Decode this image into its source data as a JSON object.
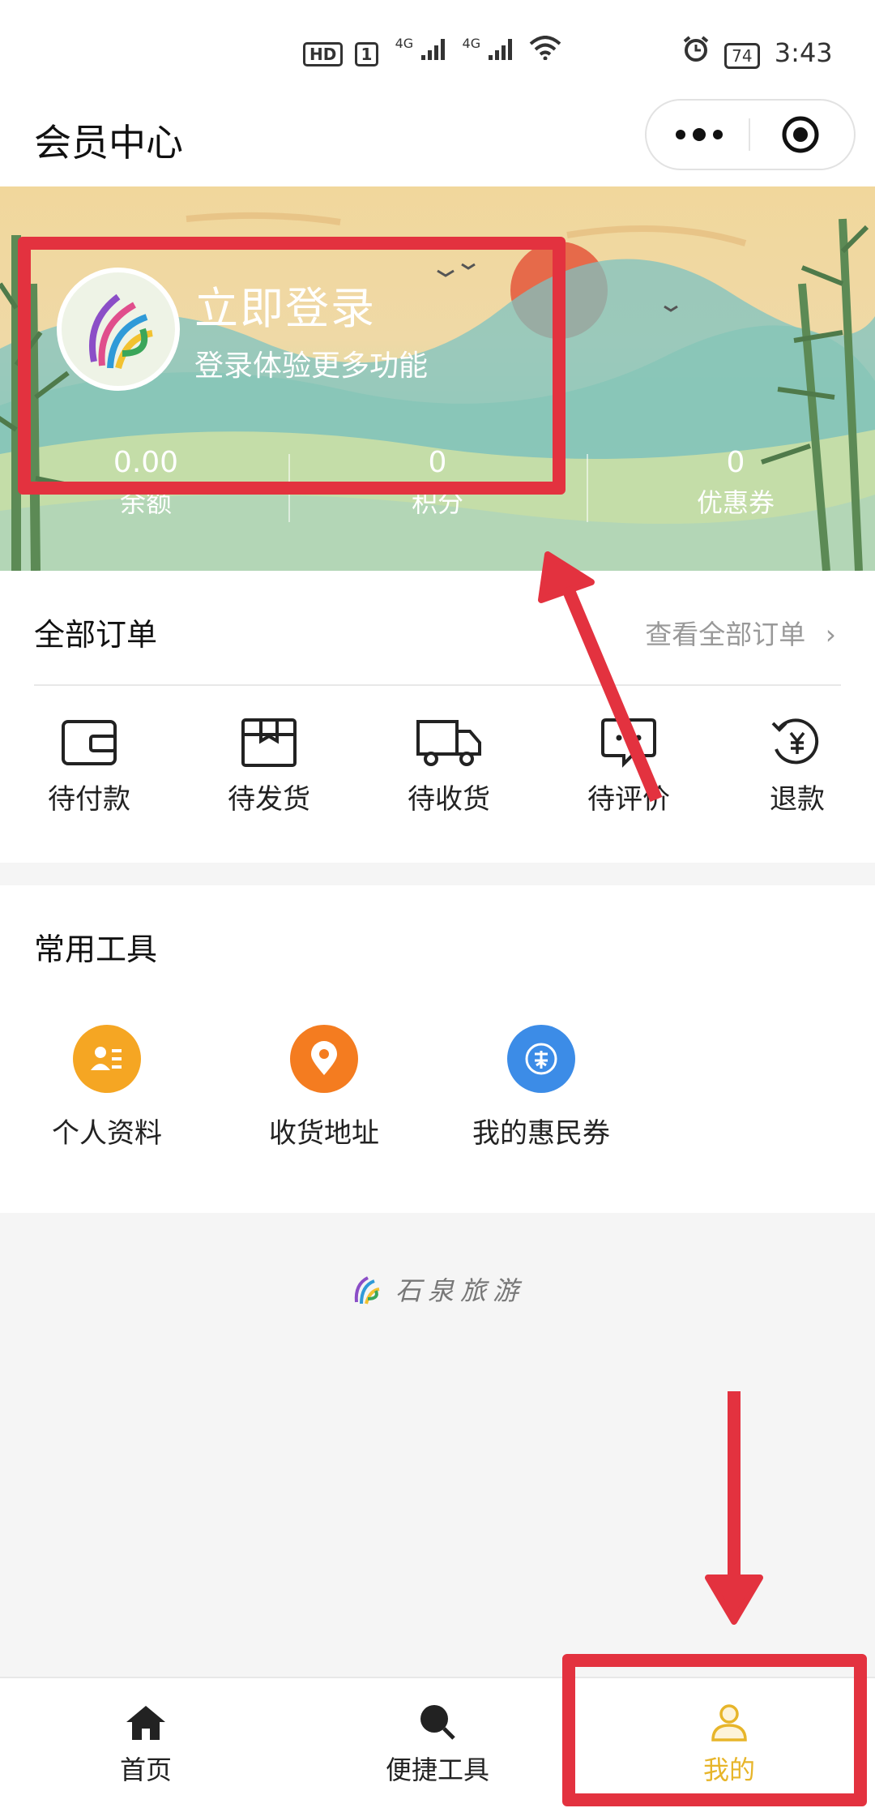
{
  "status_bar": {
    "hd_badge": "HD",
    "sim_badge": "1",
    "net1": "4G",
    "net2": "4G",
    "battery": "74",
    "time": "3:43"
  },
  "nav": {
    "title": "会员中心"
  },
  "profile": {
    "login_title": "立即登录",
    "login_subtitle": "登录体验更多功能",
    "stats": [
      {
        "value": "0.00",
        "label": "余额"
      },
      {
        "value": "0",
        "label": "积分"
      },
      {
        "value": "0",
        "label": "优惠券"
      }
    ]
  },
  "orders": {
    "title": "全部订单",
    "view_all": "查看全部订单",
    "items": [
      {
        "label": "待付款",
        "icon": "wallet-icon"
      },
      {
        "label": "待发货",
        "icon": "package-icon"
      },
      {
        "label": "待收货",
        "icon": "truck-icon"
      },
      {
        "label": "待评价",
        "icon": "comment-icon"
      },
      {
        "label": "退款",
        "icon": "refund-icon"
      }
    ]
  },
  "tools": {
    "title": "常用工具",
    "items": [
      {
        "label": "个人资料",
        "icon": "profile-card-icon",
        "color": "#f5a623"
      },
      {
        "label": "收货地址",
        "icon": "location-pin-icon",
        "color": "#f47c20"
      },
      {
        "label": "我的惠民券",
        "icon": "coupon-icon",
        "color": "#3c8ce7"
      }
    ]
  },
  "brand": {
    "name": "石泉旅游"
  },
  "tabbar": {
    "items": [
      {
        "label": "首页",
        "icon": "home-icon",
        "active": false
      },
      {
        "label": "便捷工具",
        "icon": "search-icon",
        "active": false
      },
      {
        "label": "我的",
        "icon": "user-icon",
        "active": true
      }
    ],
    "active_color": "#e7b52a"
  },
  "annotation_color": "#e3323f"
}
